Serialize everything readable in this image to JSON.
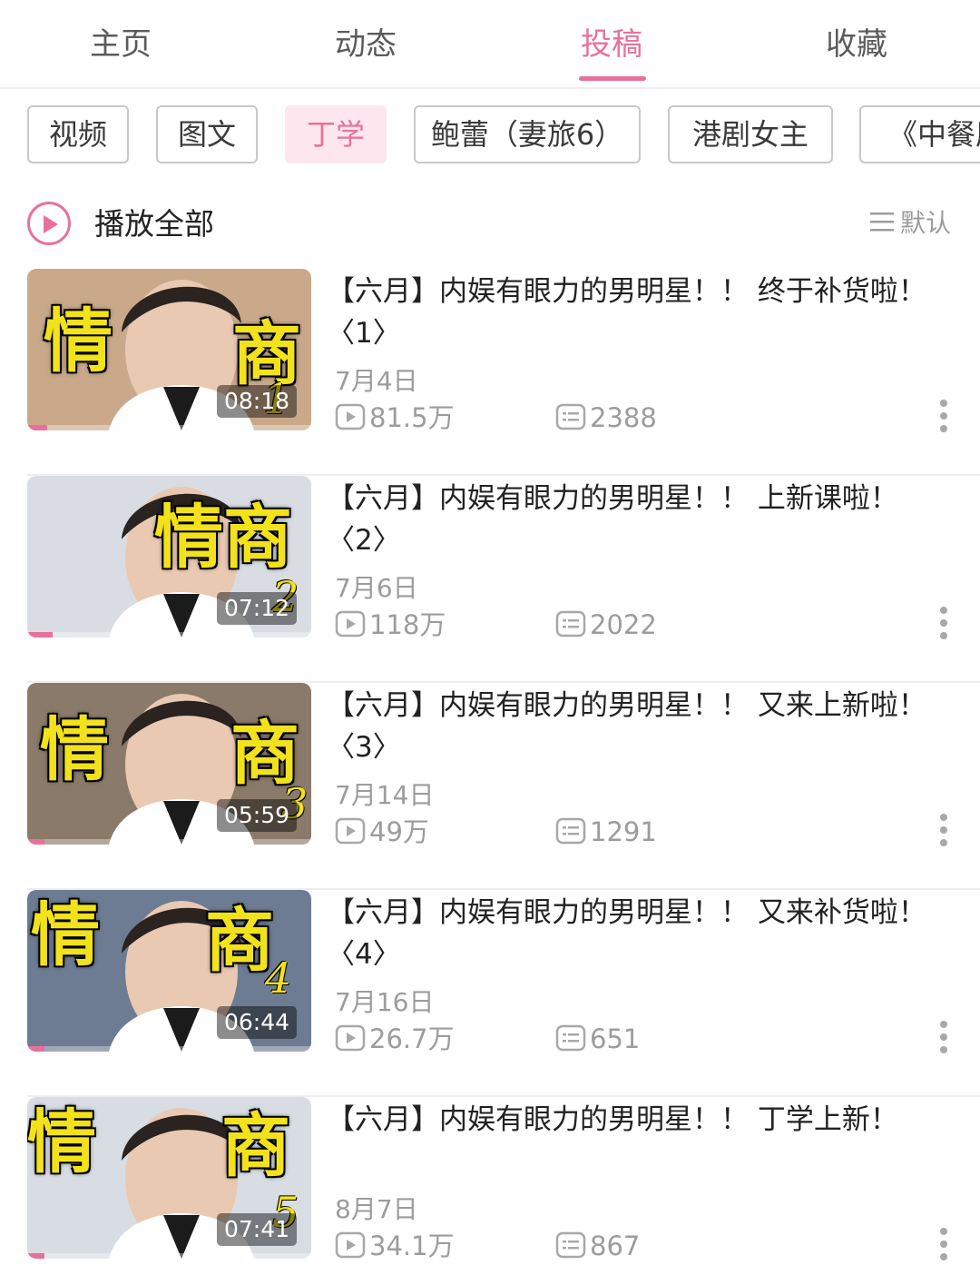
{
  "tabs": [
    {
      "label": "主页"
    },
    {
      "label": "动态"
    },
    {
      "label": "投稿",
      "active": true
    },
    {
      "label": "收藏"
    }
  ],
  "chips": [
    {
      "label": "视频"
    },
    {
      "label": "图文"
    },
    {
      "label": "丁学",
      "active": true
    },
    {
      "label": "鲍蕾（妻旅6）"
    },
    {
      "label": "港剧女主"
    },
    {
      "label": "《中餐厅"
    }
  ],
  "playall": {
    "label": "播放全部",
    "sort_label": "默认"
  },
  "videos": [
    {
      "title": "【六月】内娱有眼力的男明星！！ 终于补货啦！〈1〉",
      "date": "7月4日",
      "views": "81.5万",
      "danmaku": "2388",
      "duration": "08:18",
      "thumb_caption_left": "情",
      "thumb_caption_right": "商",
      "episode": "1",
      "watch_progress": 0.07
    },
    {
      "title": "【六月】内娱有眼力的男明星！！ 上新课啦！〈2〉",
      "date": "7月6日",
      "views": "118万",
      "danmaku": "2022",
      "duration": "07:12",
      "thumb_caption_left": "情",
      "thumb_caption_right": "商",
      "episode": "2",
      "watch_progress": 0.09
    },
    {
      "title": "【六月】内娱有眼力的男明星！！ 又来上新啦！〈3〉",
      "date": "7月14日",
      "views": "49万",
      "danmaku": "1291",
      "duration": "05:59",
      "thumb_caption_left": "情",
      "thumb_caption_right": "商",
      "episode": "3",
      "watch_progress": 0.06
    },
    {
      "title": "【六月】内娱有眼力的男明星！！ 又来补货啦！〈4〉",
      "date": "7月16日",
      "views": "26.7万",
      "danmaku": "651",
      "duration": "06:44",
      "thumb_caption_left": "情",
      "thumb_caption_right": "商",
      "episode": "4",
      "watch_progress": 0.06
    },
    {
      "title": "【六月】内娱有眼力的男明星！！ 丁学上新！",
      "date": "8月7日",
      "views": "34.1万",
      "danmaku": "867",
      "duration": "07:41",
      "thumb_caption_left": "情",
      "thumb_caption_right": "商",
      "episode": "5",
      "watch_progress": 0.06
    }
  ],
  "icons": {
    "play_all": "play-circle-icon",
    "sort": "menu-lines-icon",
    "views": "play-box-icon",
    "danmaku": "danmaku-icon",
    "more": "more-vertical-icon"
  },
  "colors": {
    "accent": "#e8719a",
    "accent_bg": "#fde6ee",
    "muted_text": "#9c9c9c",
    "caption_yellow": "#f2e21b"
  }
}
